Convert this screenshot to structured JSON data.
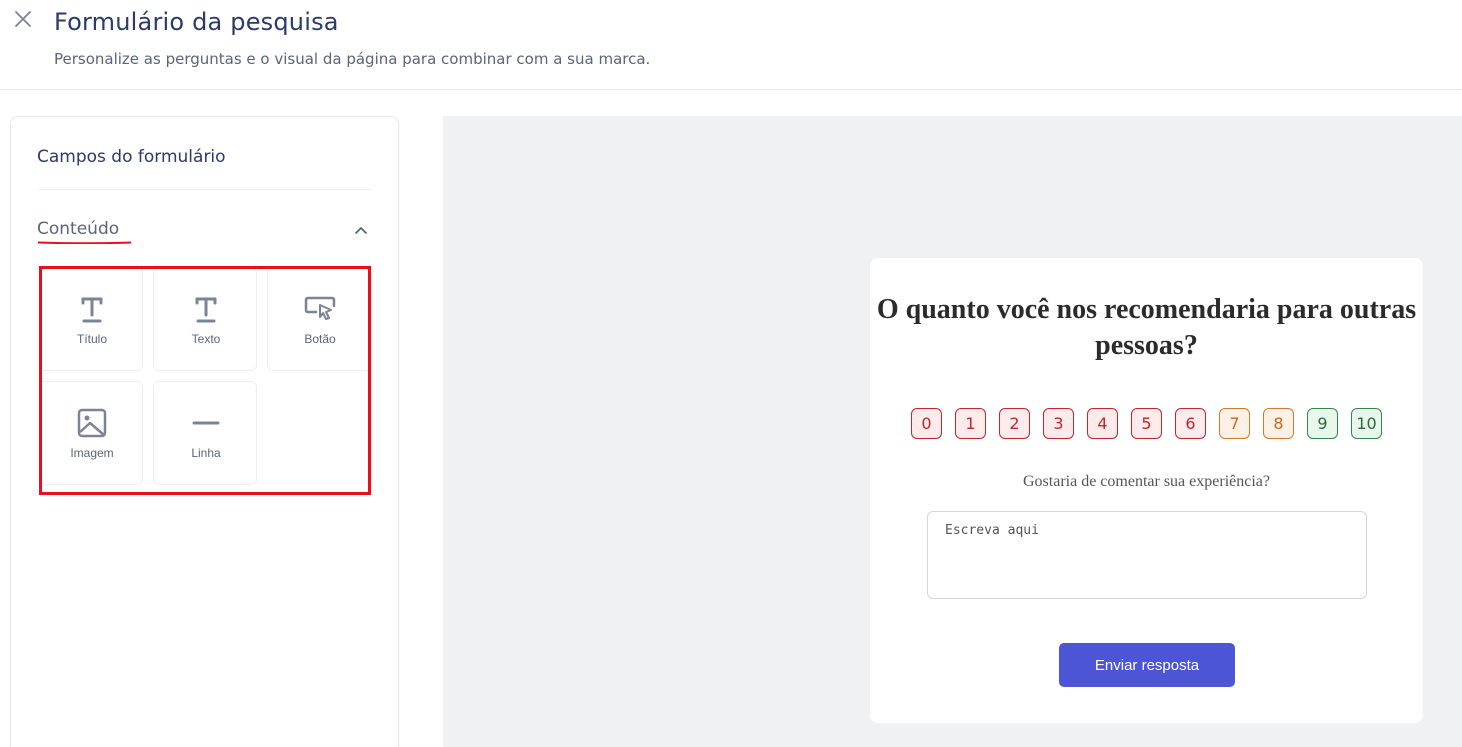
{
  "header": {
    "title": "Formulário da pesquisa",
    "subtitle": "Personalize as perguntas e o visual da página para combinar com a sua marca."
  },
  "sidebar": {
    "title": "Campos do formulário",
    "section": {
      "label": "Conteúdo",
      "expanded": true
    },
    "fields": [
      {
        "label": "Título",
        "icon": "title-icon"
      },
      {
        "label": "Texto",
        "icon": "text-icon"
      },
      {
        "label": "Botão",
        "icon": "button-cursor-icon"
      },
      {
        "label": "Imagem",
        "icon": "image-icon"
      },
      {
        "label": "Linha",
        "icon": "line-icon"
      }
    ]
  },
  "preview": {
    "question": "O quanto você nos recomendaria para outras pessoas?",
    "scale": [
      {
        "value": "0",
        "tone": "red"
      },
      {
        "value": "1",
        "tone": "red"
      },
      {
        "value": "2",
        "tone": "red"
      },
      {
        "value": "3",
        "tone": "red"
      },
      {
        "value": "4",
        "tone": "red"
      },
      {
        "value": "5",
        "tone": "red"
      },
      {
        "value": "6",
        "tone": "red"
      },
      {
        "value": "7",
        "tone": "orange"
      },
      {
        "value": "8",
        "tone": "orange"
      },
      {
        "value": "9",
        "tone": "green"
      },
      {
        "value": "10",
        "tone": "green"
      }
    ],
    "comment_label": "Gostaria de comentar sua experiência?",
    "comment_placeholder": "Escreva aqui",
    "submit_label": "Enviar resposta"
  },
  "colors": {
    "accent": "#4b55d6",
    "highlight": "#e8101e",
    "detractor": "#c0262d",
    "passive": "#d07a2a",
    "promoter": "#2f8a4a"
  }
}
